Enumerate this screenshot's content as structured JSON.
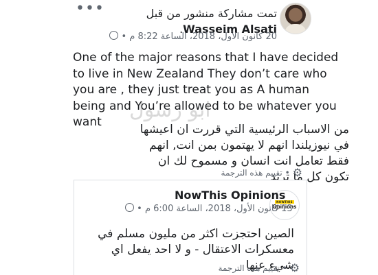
{
  "post": {
    "more_icon": "more-dots-icon",
    "more_glyph": "•••",
    "header_prefix": "تمت مشاركة منشور من قبل",
    "author": "Wasseim Alsati",
    "header_suffix": ".",
    "timestamp": "20 كانون الأول، 2018، الساعة 8:22 م",
    "privacy_icon": "globe-icon",
    "body_en": "One of the major reasons that I have decided to live in New Zealand They don’t care who you are , they just treat you as A human being and You’re allowed to be whatever you want",
    "watermark": "ابو رسول",
    "body_ar": "من الاسباب الرئيسية التي قررت ان اعيشها في نيوزيلندا انهم لا يهتمون بمن انت, انهم فقط تعامل انت انسان و مسموح لك ان تكون كل ما تريد",
    "rate_translation": "تقييم هذه الترجمة",
    "rate_icon": "gear-icon"
  },
  "shared": {
    "page_name": "NowThis Opinions",
    "logo_top": "NOWTHIS",
    "logo_bottom": "Opinions",
    "timestamp": "13 كانون الأول، 2018، الساعة 6:00 م",
    "privacy_icon": "globe-icon",
    "body_ar": "الصين احتجزت اكثر من مليون مسلم في معسكرات الاعتقال - و لا احد يفعل اي شيء عنها",
    "rate_translation": "تقييم هذه الترجمة",
    "rate_icon": "gear-icon"
  }
}
